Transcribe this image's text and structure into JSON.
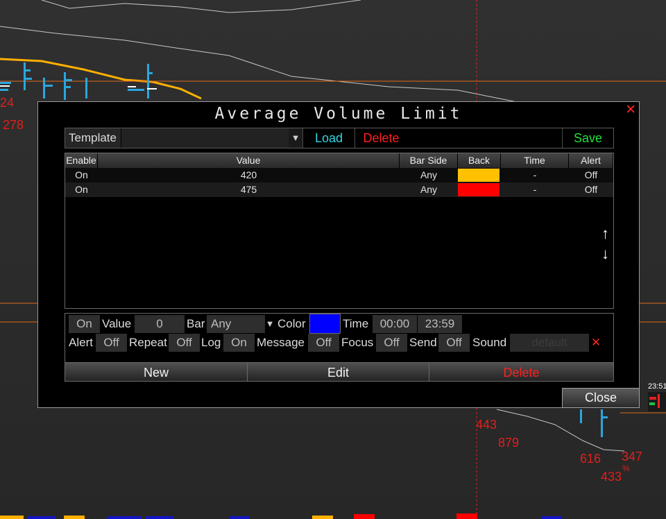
{
  "dialog": {
    "title": "Average Volume Limit",
    "close_glyph": "✕"
  },
  "template_bar": {
    "label": "Template",
    "dropdown_glyph": "▼",
    "load": "Load",
    "delete": "Delete",
    "save": "Save"
  },
  "table": {
    "headers": [
      "Enable",
      "Value",
      "Bar Side",
      "Back",
      "Time",
      "Alert"
    ],
    "rows": [
      {
        "enable": "On",
        "value": "420",
        "bar_side": "Any",
        "back_color": "#ffc000",
        "time": "-",
        "alert": "Off"
      },
      {
        "enable": "On",
        "value": "475",
        "bar_side": "Any",
        "back_color": "#ff0000",
        "time": "-",
        "alert": "Off"
      }
    ],
    "scroll_up": "↑",
    "scroll_down": "↓"
  },
  "editor": {
    "enable": "On",
    "value_label": "Value",
    "value": "0",
    "bar_label": "Bar",
    "bar_value": "Any",
    "bar_dropdown_glyph": "▼",
    "color_label": "Color",
    "color": "#0000ff",
    "time_label": "Time",
    "time_start": "00:00",
    "time_end": "23:59",
    "alert_label": "Alert",
    "alert": "Off",
    "repeat_label": "Repeat",
    "repeat": "Off",
    "log_label": "Log",
    "log": "On",
    "message_label": "Message",
    "message": "Off",
    "focus_label": "Focus",
    "focus": "Off",
    "send_label": "Send",
    "send": "Off",
    "sound_label": "Sound",
    "sound": "default",
    "clear_glyph": "✕"
  },
  "footer": {
    "new": "New",
    "edit": "Edit",
    "delete": "Delete"
  },
  "close_button": "Close",
  "background_chart": {
    "labels": [
      "24",
      "278",
      "443",
      "879",
      "616",
      "347",
      "433",
      "%",
      "23:51"
    ]
  }
}
